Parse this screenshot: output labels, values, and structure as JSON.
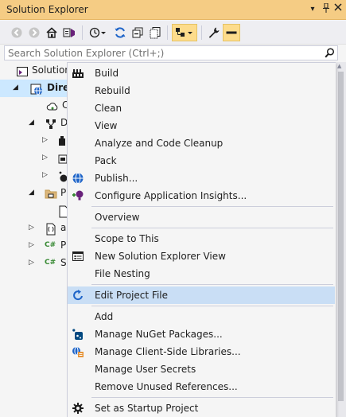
{
  "window": {
    "title": "Solution Explorer",
    "dropdown_glyph": "▾",
    "pin_glyph": "📌"
  },
  "search": {
    "placeholder": "Search Solution Explorer (Ctrl+;)"
  },
  "tree": {
    "rows": [
      {
        "label": "Solution",
        "icon": "solution-icon"
      },
      {
        "label": "Dire",
        "icon": "web-project-icon",
        "bold": true
      },
      {
        "label": "C",
        "icon": "connected-services-icon"
      },
      {
        "label": "D",
        "icon": "dependencies-icon"
      },
      {
        "label": "",
        "icon": "analyzers-icon"
      },
      {
        "label": "",
        "icon": "frameworks-icon"
      },
      {
        "label": "",
        "icon": "packages-icon"
      },
      {
        "label": "P",
        "icon": "properties-folder-icon"
      },
      {
        "label": "",
        "icon": "launch-settings-icon"
      },
      {
        "label": "a",
        "icon": "appsettings-icon"
      },
      {
        "label": "P",
        "icon": "csharp-file-icon"
      },
      {
        "label": "S",
        "icon": "csharp-file-icon"
      }
    ],
    "csharp_badge": "C#"
  },
  "context_menu": {
    "groups": [
      [
        {
          "label": "Build",
          "icon": "build-icon"
        },
        {
          "label": "Rebuild",
          "icon": ""
        },
        {
          "label": "Clean",
          "icon": ""
        },
        {
          "label": "View",
          "icon": ""
        },
        {
          "label": "Analyze and Code Cleanup",
          "icon": ""
        },
        {
          "label": "Pack",
          "icon": ""
        },
        {
          "label": "Publish...",
          "icon": "publish-globe-icon"
        },
        {
          "label": "Configure Application Insights...",
          "icon": "app-insights-icon"
        }
      ],
      [
        {
          "label": "Overview",
          "icon": ""
        }
      ],
      [
        {
          "label": "Scope to This",
          "icon": ""
        },
        {
          "label": "New Solution Explorer View",
          "icon": "new-view-icon"
        },
        {
          "label": "File Nesting",
          "icon": ""
        }
      ],
      [
        {
          "label": "Edit Project File",
          "icon": "edit-project-file-icon",
          "hover": true
        }
      ],
      [
        {
          "label": "Add",
          "icon": ""
        },
        {
          "label": "Manage NuGet Packages...",
          "icon": "nuget-icon"
        },
        {
          "label": "Manage Client-Side Libraries...",
          "icon": "client-libraries-icon"
        },
        {
          "label": "Manage User Secrets",
          "icon": ""
        },
        {
          "label": "Remove Unused References...",
          "icon": ""
        }
      ],
      [
        {
          "label": "Set as Startup Project",
          "icon": "gear-icon"
        }
      ]
    ]
  },
  "colors": {
    "titlebar": "#f5cc84",
    "selection": "#cce8ff",
    "menu_hover": "#c9def5",
    "accent_blue": "#1e64c8",
    "csharp_green": "#388a34"
  }
}
